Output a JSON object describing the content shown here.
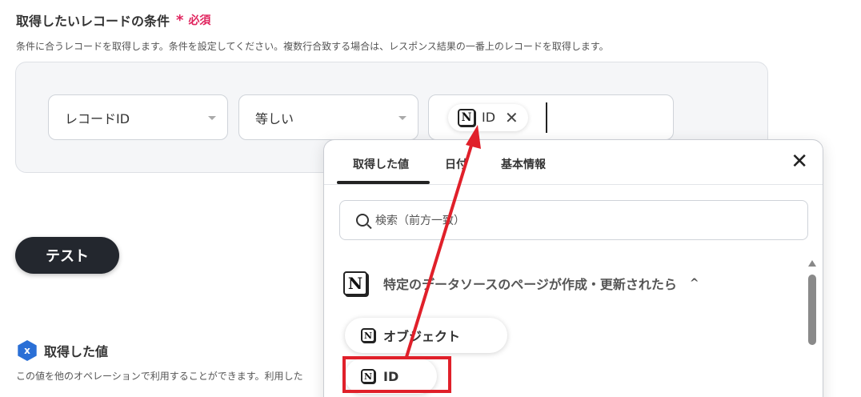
{
  "section": {
    "title": "取得したいレコードの条件",
    "required_star": "*",
    "required_label": "必須",
    "description": "条件に合うレコードを取得します。条件を設定してください。複数行合致する場合は、レスポンス結果の一番上のレコードを取得します。"
  },
  "condition": {
    "field_select": "レコードID",
    "operator_select": "等しい",
    "value_chip": "ID",
    "value_chip_remove": "✕"
  },
  "test_button": "テスト",
  "result": {
    "title": "取得した値",
    "icon_text": "x",
    "description": "この値を他のオペレーションで利用することができます。利用した"
  },
  "dropdown": {
    "tabs": [
      "取得した値",
      "日付",
      "基本情報"
    ],
    "close": "✕",
    "search_placeholder": "検索（前方一致）",
    "source_title": "特定のデータソースのページが作成・更新されたら",
    "source_chevron": "^",
    "items": [
      "オブジェクト",
      "ID"
    ]
  },
  "icons": {
    "notion": "N"
  },
  "colors": {
    "required": "#e0245e",
    "annotation": "#e0202a",
    "button_dark": "#23272e"
  }
}
